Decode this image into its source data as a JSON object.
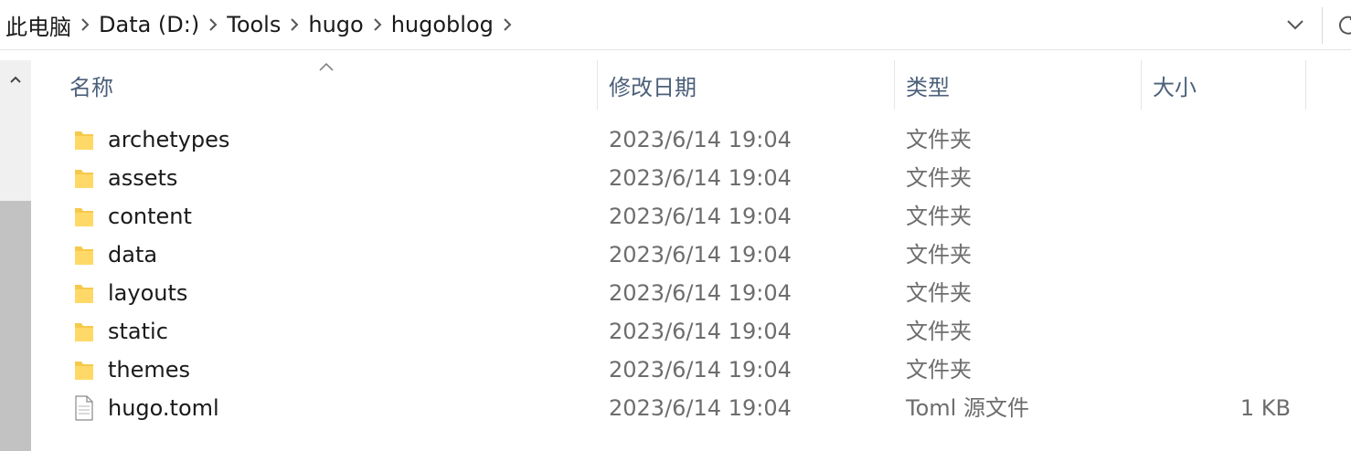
{
  "breadcrumb": {
    "items": [
      "此电脑",
      "Data (D:)",
      "Tools",
      "hugo",
      "hugoblog"
    ]
  },
  "columns": {
    "name": "名称",
    "modified": "修改日期",
    "type": "类型",
    "size": "大小"
  },
  "sort": {
    "column": "name",
    "direction": "ascending"
  },
  "files": [
    {
      "name": "archetypes",
      "modified": "2023/6/14 19:04",
      "type": "文件夹",
      "size": "",
      "icon": "folder-icon"
    },
    {
      "name": "assets",
      "modified": "2023/6/14 19:04",
      "type": "文件夹",
      "size": "",
      "icon": "folder-icon"
    },
    {
      "name": "content",
      "modified": "2023/6/14 19:04",
      "type": "文件夹",
      "size": "",
      "icon": "folder-icon"
    },
    {
      "name": "data",
      "modified": "2023/6/14 19:04",
      "type": "文件夹",
      "size": "",
      "icon": "folder-icon"
    },
    {
      "name": "layouts",
      "modified": "2023/6/14 19:04",
      "type": "文件夹",
      "size": "",
      "icon": "folder-icon"
    },
    {
      "name": "static",
      "modified": "2023/6/14 19:04",
      "type": "文件夹",
      "size": "",
      "icon": "folder-icon"
    },
    {
      "name": "themes",
      "modified": "2023/6/14 19:04",
      "type": "文件夹",
      "size": "",
      "icon": "folder-icon"
    },
    {
      "name": "hugo.toml",
      "modified": "2023/6/14 19:04",
      "type": "Toml 源文件",
      "size": "1 KB",
      "icon": "document-icon"
    }
  ],
  "colors": {
    "folder": "#f6c94a",
    "header_text": "#4c607a",
    "secondary_text": "#6d6d6d",
    "scroll_thumb": "#c2c2c2"
  }
}
